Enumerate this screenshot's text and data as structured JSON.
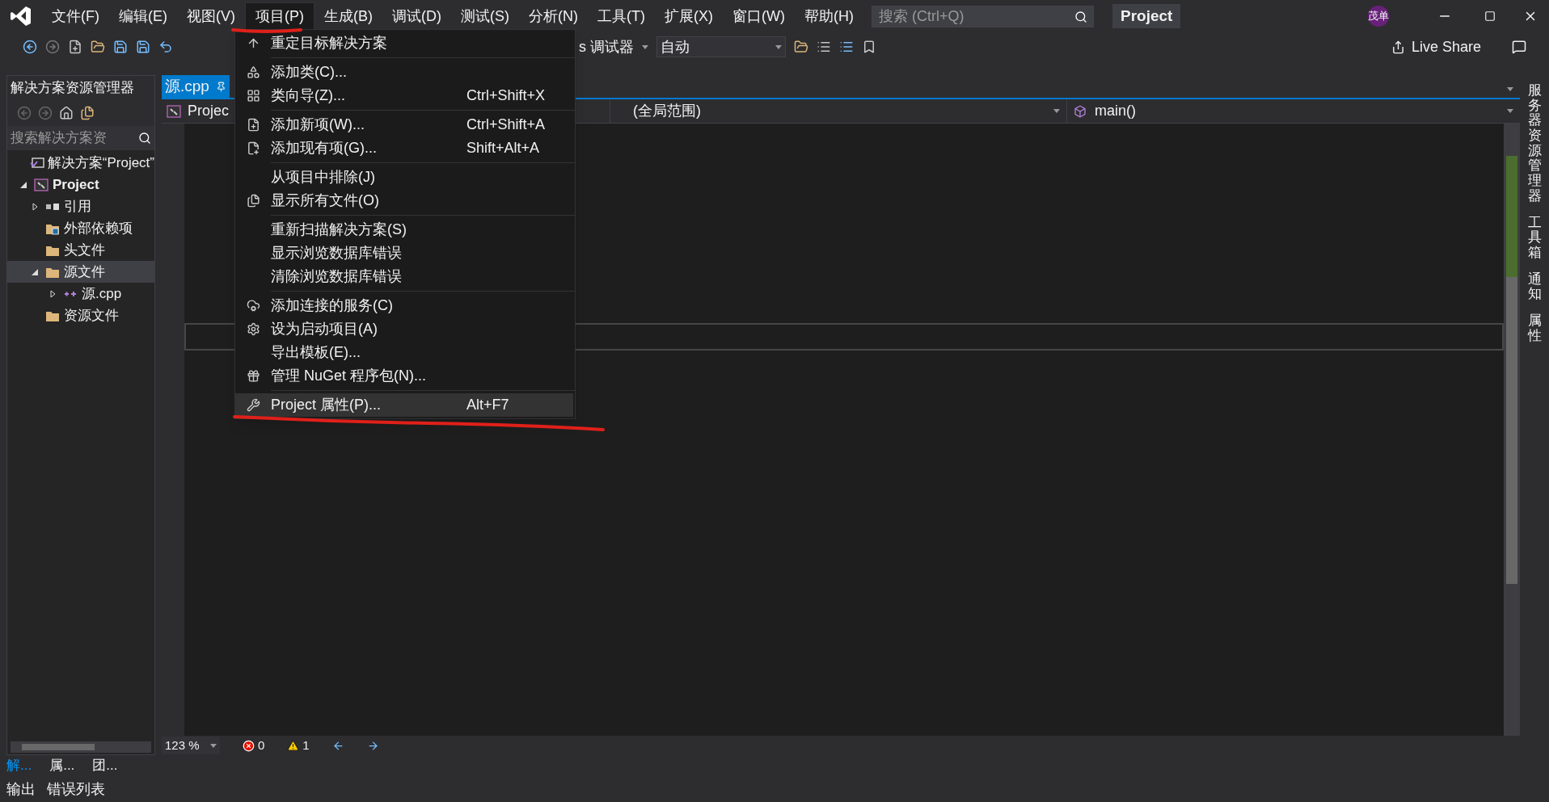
{
  "menu_bar": [
    {
      "label": "文件(F)",
      "selected": false
    },
    {
      "label": "编辑(E)",
      "selected": false
    },
    {
      "label": "视图(V)",
      "selected": false
    },
    {
      "label": "项目(P)",
      "selected": true
    },
    {
      "label": "生成(B)",
      "selected": false
    },
    {
      "label": "调试(D)",
      "selected": false
    },
    {
      "label": "测试(S)",
      "selected": false
    },
    {
      "label": "分析(N)",
      "selected": false
    },
    {
      "label": "工具(T)",
      "selected": false
    },
    {
      "label": "扩展(X)",
      "selected": false
    },
    {
      "label": "窗口(W)",
      "selected": false
    },
    {
      "label": "帮助(H)",
      "selected": false
    }
  ],
  "search": {
    "placeholder": "搜索 (Ctrl+Q)"
  },
  "solution_badge": "Project",
  "account": "茂单",
  "toolbar": {
    "debugger": "s 调试器",
    "config": "自动",
    "live_share": "Live Share"
  },
  "solution_explorer": {
    "title": "解决方案资源管理器",
    "search_placeholder": "搜索解决方案资",
    "tree": [
      {
        "label": "解决方案“Project”",
        "kind": "solution",
        "bold": false,
        "selected": false
      },
      {
        "label": "Project",
        "kind": "project",
        "bold": true,
        "expanded": true,
        "selected": false,
        "children": [
          {
            "label": "引用",
            "kind": "references",
            "expanded": false,
            "selected": false
          },
          {
            "label": "外部依赖项",
            "kind": "external",
            "selected": false
          },
          {
            "label": "头文件",
            "kind": "folder",
            "selected": false
          },
          {
            "label": "源文件",
            "kind": "folder",
            "expanded": true,
            "selected": true,
            "children": [
              {
                "label": "源.cpp",
                "kind": "cpp",
                "expanded": false,
                "selected": false
              }
            ]
          },
          {
            "label": "资源文件",
            "kind": "folder",
            "selected": false
          }
        ]
      }
    ],
    "tabs": [
      {
        "label": "解...",
        "selected": true
      },
      {
        "label": "属...",
        "selected": false
      },
      {
        "label": "团...",
        "selected": false
      }
    ]
  },
  "editor": {
    "tab": "源.cpp",
    "nav": {
      "project": "Projec",
      "scope": "(全局范围)",
      "member": "main()"
    }
  },
  "context_menu": {
    "groups": [
      [
        {
          "label": "重定目标解决方案",
          "selected": false
        }
      ],
      [
        {
          "label": "添加类(C)...",
          "selected": false
        },
        {
          "label": "类向导(Z)...",
          "shortcut": "Ctrl+Shift+X",
          "selected": false
        }
      ],
      [
        {
          "label": "添加新项(W)...",
          "shortcut": "Ctrl+Shift+A",
          "selected": false
        },
        {
          "label": "添加现有项(G)...",
          "shortcut": "Shift+Alt+A",
          "selected": false
        }
      ],
      [
        {
          "label": "从项目中排除(J)",
          "selected": false
        },
        {
          "label": "显示所有文件(O)",
          "selected": false
        }
      ],
      [
        {
          "label": "重新扫描解决方案(S)",
          "selected": false
        },
        {
          "label": "显示浏览数据库错误",
          "selected": false
        },
        {
          "label": "清除浏览数据库错误",
          "selected": false
        }
      ],
      [
        {
          "label": "添加连接的服务(C)",
          "selected": false
        },
        {
          "label": "设为启动项目(A)",
          "selected": false
        },
        {
          "label": "导出模板(E)...",
          "selected": false
        },
        {
          "label": "管理 NuGet 程序包(N)...",
          "selected": false
        }
      ],
      [
        {
          "label": "Project 属性(P)...",
          "shortcut": "Alt+F7",
          "selected": true
        }
      ]
    ]
  },
  "status": {
    "zoom": "123 %",
    "errors": "0",
    "warnings": "1"
  },
  "right_tabs": [
    "服务器资源管理器",
    "工具箱",
    "通知",
    "属性"
  ],
  "bottom_tabs": [
    "输出",
    "错误列表"
  ]
}
